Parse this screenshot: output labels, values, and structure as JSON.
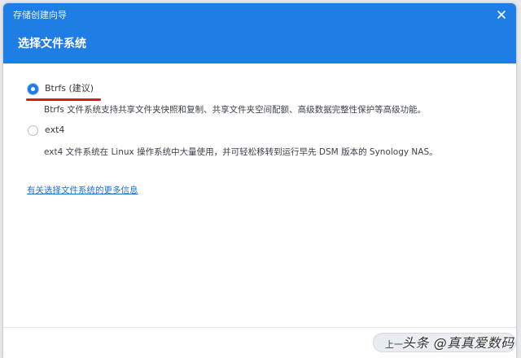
{
  "window": {
    "title": "存储创建向导"
  },
  "header": {
    "step_title": "选择文件系统",
    "bg_color": "#1f7de6"
  },
  "options": [
    {
      "label": "Btrfs (建议)",
      "selected": true,
      "description": "Btrfs 文件系统支持共享文件夹快照和复制、共享文件夹空间配额、高级数据完整性保护等高级功能。"
    },
    {
      "label": "ext4",
      "selected": false,
      "description": "ext4 文件系统在 Linux 操作系统中大量使用，并可轻松移转到运行早先 DSM 版本的 Synology NAS。"
    }
  ],
  "info_link": "有关选择文件系统的更多信息",
  "footer": {
    "prev_label": "上一",
    "watermark": "头条 @真真爱数码"
  },
  "annotation_color": "#e3151a"
}
